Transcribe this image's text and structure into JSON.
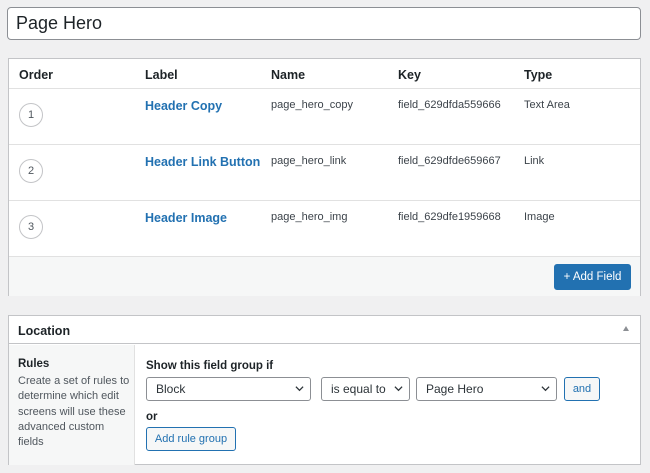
{
  "field_group": {
    "title_value": "Page Hero"
  },
  "fields_table": {
    "columns": {
      "order": "Order",
      "label": "Label",
      "name": "Name",
      "key": "Key",
      "type": "Type"
    },
    "rows": [
      {
        "order": "1",
        "label": "Header Copy",
        "name": "page_hero_copy",
        "key": "field_629dfda559666",
        "type": "Text Area"
      },
      {
        "order": "2",
        "label": "Header Link Button",
        "name": "page_hero_link",
        "key": "field_629dfde659667",
        "type": "Link"
      },
      {
        "order": "3",
        "label": "Header Image",
        "name": "page_hero_img",
        "key": "field_629dfe1959668",
        "type": "Image"
      }
    ],
    "add_field_label": "+ Add Field"
  },
  "location": {
    "title": "Location",
    "rules_title": "Rules",
    "rules_description": "Create a set of rules to determine which edit screens will use these advanced custom fields",
    "show_if_label": "Show this field group if",
    "rule": {
      "param": "Block",
      "operator": "is equal to",
      "value": "Page Hero"
    },
    "and_label": "and",
    "or_label": "or",
    "add_rule_group_label": "Add rule group"
  },
  "colors": {
    "accent": "#2271b1",
    "page_bg": "#f0f0f1",
    "border": "#c3c4c7"
  },
  "icons": [
    "chevron-down-icon",
    "collapse-up-icon"
  ]
}
